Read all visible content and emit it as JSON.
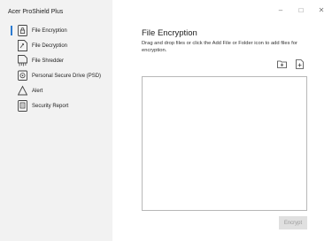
{
  "app": {
    "title": "Acer ProShield Plus"
  },
  "window": {
    "minimize": "–",
    "maximize": "□",
    "close": "✕"
  },
  "sidebar": {
    "items": [
      {
        "label": "File Encryption",
        "icon": "lock-file-icon",
        "active": true
      },
      {
        "label": "File Decryption",
        "icon": "unlock-file-icon",
        "active": false
      },
      {
        "label": "File Shredder",
        "icon": "shredder-icon",
        "active": false
      },
      {
        "label": "Personal Secure Drive (PSD)",
        "icon": "drive-icon",
        "active": false
      },
      {
        "label": "Alert",
        "icon": "alert-triangle-icon",
        "active": false
      },
      {
        "label": "Security Report",
        "icon": "report-icon",
        "active": false
      }
    ]
  },
  "main": {
    "title": "File Encryption",
    "description": "Drag and drop files or click the Add File or Folder icon to add files for encryption.",
    "encrypt_label": "Encrypt"
  },
  "colors": {
    "accent": "#2b7bd1",
    "sidebar_bg": "#f2f2f2"
  }
}
